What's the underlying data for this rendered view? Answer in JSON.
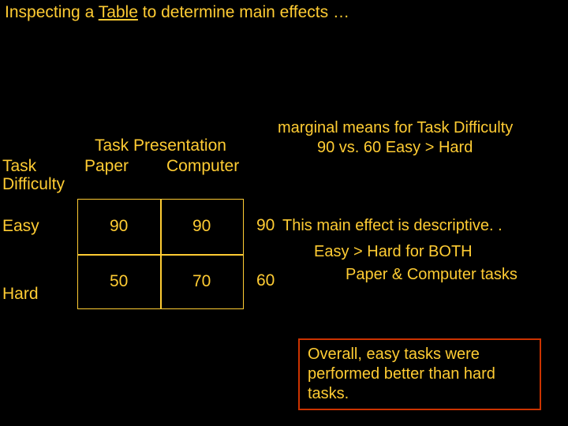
{
  "title_prefix": "Inspecting a ",
  "title_underlined": "Table",
  "title_suffix": " to determine main effects …",
  "headers": {
    "task_presentation": "Task Presentation",
    "paper": "Paper",
    "computer": "Computer",
    "task_difficulty_line1": "Task",
    "task_difficulty_line2": "Difficulty",
    "easy": "Easy",
    "hard": "Hard"
  },
  "cells": {
    "easy_paper": "90",
    "easy_computer": "90",
    "hard_paper": "50",
    "hard_computer": "70"
  },
  "marginals": {
    "easy": "90",
    "hard": "60"
  },
  "marginal_note": {
    "line1": "marginal means for Task Difficulty",
    "line2": "90 vs. 60     Easy > Hard"
  },
  "descriptive": {
    "line1": "This main effect is descriptive. .",
    "line2": "Easy > Hard for BOTH",
    "line3": "Paper & Computer tasks"
  },
  "conclusion": "Overall, easy tasks were performed better than hard tasks.",
  "chart_data": {
    "type": "table",
    "row_factor": "Task Difficulty",
    "col_factor": "Task Presentation",
    "rows": [
      "Easy",
      "Hard"
    ],
    "cols": [
      "Paper",
      "Computer"
    ],
    "values": [
      [
        90,
        90
      ],
      [
        50,
        70
      ]
    ],
    "row_marginal_means": [
      90,
      60
    ],
    "comparison": "Easy > Hard",
    "main_effect": "descriptive"
  }
}
